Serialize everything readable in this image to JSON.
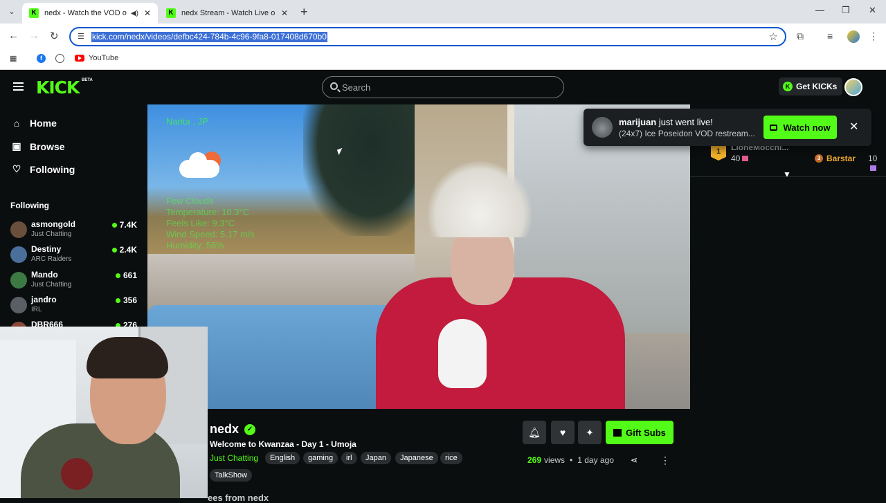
{
  "browser": {
    "tabs": [
      {
        "title": "nedx - Watch the VOD on Kick",
        "active": true
      },
      {
        "title": "nedx Stream - Watch Live on Kick",
        "active": false
      }
    ],
    "url": "kick.com/nedx/videos/defbc424-784b-4c96-9fa8-017408d670b0",
    "bookmarks": [
      {
        "label": "YouTube"
      }
    ]
  },
  "header": {
    "logo": "KICK",
    "beta": "BETA",
    "search_placeholder": "Search",
    "get_kicks": "Get KICKs"
  },
  "sidebar": {
    "nav": [
      {
        "label": "Home",
        "icon": "home-icon"
      },
      {
        "label": "Browse",
        "icon": "browse-icon"
      },
      {
        "label": "Following",
        "icon": "heart-icon"
      }
    ],
    "following_title": "Following",
    "channels": [
      {
        "name": "asmongold",
        "category": "Just Chatting",
        "viewers": "7.4K",
        "color": "#6b4f3d"
      },
      {
        "name": "Destiny",
        "category": "ARC Raiders",
        "viewers": "2.4K",
        "color": "#4a6f9a"
      },
      {
        "name": "Mando",
        "category": "Just Chatting",
        "viewers": "661",
        "color": "#3d7a43"
      },
      {
        "name": "jandro",
        "category": "IRL",
        "viewers": "356",
        "color": "#5a5f66"
      },
      {
        "name": "DBR666",
        "category": "",
        "viewers": "276",
        "color": "#8a4a3a"
      }
    ]
  },
  "video_overlay": {
    "city": "Narita , JP",
    "lines": [
      "Few Clouds",
      "Temperature: 10.3°C",
      "Feels Like: 9.3°C",
      "Wind Speed: 5.17 m/s",
      "Humidity: 56%"
    ]
  },
  "chat": {
    "leader_name": "LioneMocchi...",
    "leader_count": "40",
    "leader_rank": "1",
    "barstar_label": "Barstar",
    "barstar_count": "10"
  },
  "notification": {
    "user": "marijuan",
    "text": " just went live!",
    "subtitle": "(24x7) Ice Poseidon VOD restream...",
    "button": "Watch now"
  },
  "stream": {
    "streamer": "nedx",
    "title": "Welcome to Kwanzaa - Day 1 - Umoja",
    "category": "Just Chatting",
    "tags": [
      "English",
      "gaming",
      "irl",
      "Japan",
      "Japanese",
      "rice",
      "TalkShow"
    ],
    "gift_label": "Gift Subs",
    "views": "269",
    "views_label": "views",
    "age": "1 day ago",
    "more_from": "ees from nedx"
  }
}
